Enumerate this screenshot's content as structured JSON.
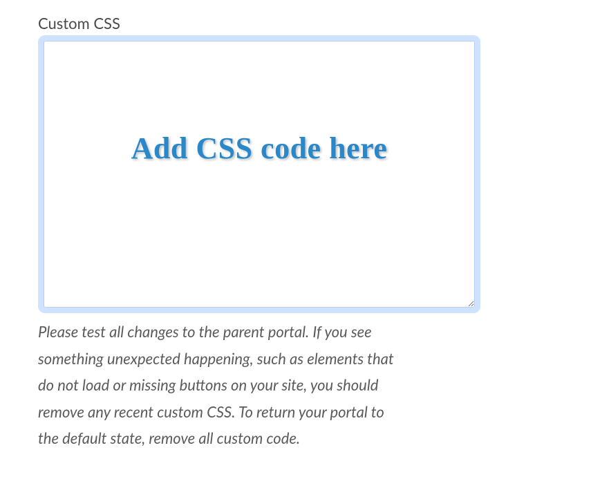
{
  "form": {
    "custom_css_label": "Custom CSS",
    "custom_css_value": "",
    "overlay_instruction": "Add CSS code here",
    "help_text": "Please test all changes to the parent portal. If you see something unexpected happening, such as elements that do not load or missing buttons on your site, you should remove any recent custom CSS. To return your portal to the default state, remove all custom code."
  }
}
